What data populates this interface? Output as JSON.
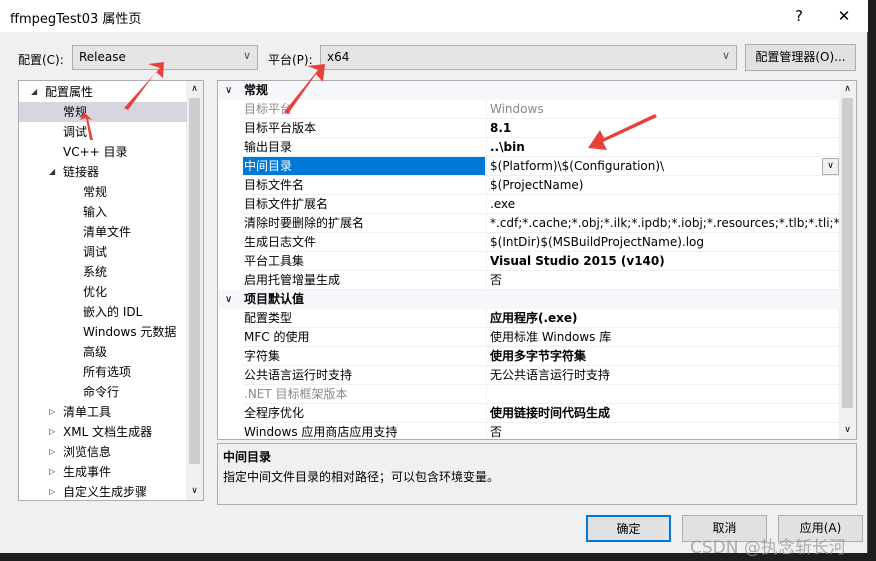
{
  "window": {
    "title": "ffmpegTest03 属性页",
    "help": "?",
    "close": "✕"
  },
  "toolbar": {
    "config_label": "配置(C):",
    "config_value": "Release",
    "platform_label": "平台(P):",
    "platform_value": "x64",
    "manager_button": "配置管理器(O)..."
  },
  "tree": [
    {
      "label": "配置属性",
      "expander": "◢",
      "indent": 0
    },
    {
      "label": "常规",
      "indent": 1,
      "selected": true
    },
    {
      "label": "调试",
      "indent": 1
    },
    {
      "label": "VC++ 目录",
      "indent": 1
    },
    {
      "label": "链接器",
      "expander": "◢",
      "indent": 1
    },
    {
      "label": "常规",
      "indent": 2
    },
    {
      "label": "输入",
      "indent": 2
    },
    {
      "label": "清单文件",
      "indent": 2
    },
    {
      "label": "调试",
      "indent": 2
    },
    {
      "label": "系统",
      "indent": 2
    },
    {
      "label": "优化",
      "indent": 2
    },
    {
      "label": "嵌入的 IDL",
      "indent": 2
    },
    {
      "label": "Windows 元数据",
      "indent": 2
    },
    {
      "label": "高级",
      "indent": 2
    },
    {
      "label": "所有选项",
      "indent": 2
    },
    {
      "label": "命令行",
      "indent": 2
    },
    {
      "label": "清单工具",
      "expander": "▷",
      "indent": 1
    },
    {
      "label": "XML 文档生成器",
      "expander": "▷",
      "indent": 1
    },
    {
      "label": "浏览信息",
      "expander": "▷",
      "indent": 1
    },
    {
      "label": "生成事件",
      "expander": "▷",
      "indent": 1
    },
    {
      "label": "自定义生成步骤",
      "expander": "▷",
      "indent": 1
    }
  ],
  "grid": [
    {
      "category": "常规"
    },
    {
      "key": "目标平台",
      "value": "Windows",
      "disabled": true
    },
    {
      "key": "目标平台版本",
      "value": "8.1",
      "bold": true
    },
    {
      "key": "输出目录",
      "value": "..\\bin",
      "bold": true
    },
    {
      "key": "中间目录",
      "value": "$(Platform)\\$(Configuration)\\",
      "selected": true
    },
    {
      "key": "目标文件名",
      "value": "$(ProjectName)"
    },
    {
      "key": "目标文件扩展名",
      "value": ".exe"
    },
    {
      "key": "清除时要删除的扩展名",
      "value": "*.cdf;*.cache;*.obj;*.ilk;*.ipdb;*.iobj;*.resources;*.tlb;*.tli;*.tlh;*.tmp"
    },
    {
      "key": "生成日志文件",
      "value": "$(IntDir)$(MSBuildProjectName).log"
    },
    {
      "key": "平台工具集",
      "value": "Visual Studio 2015 (v140)",
      "bold": true
    },
    {
      "key": "启用托管增量生成",
      "value": "否"
    },
    {
      "category": "项目默认值"
    },
    {
      "key": "配置类型",
      "value": "应用程序(.exe)",
      "bold": true
    },
    {
      "key": "MFC 的使用",
      "value": "使用标准 Windows 库"
    },
    {
      "key": "字符集",
      "value": "使用多字节字符集",
      "bold": true
    },
    {
      "key": "公共语言运行时支持",
      "value": "无公共语言运行时支持"
    },
    {
      "key": ".NET 目标框架版本",
      "value": "",
      "disabled": true
    },
    {
      "key": "全程序优化",
      "value": "使用链接时间代码生成",
      "bold": true
    },
    {
      "key": "Windows 应用商店应用支持",
      "value": "否"
    }
  ],
  "description": {
    "title": "中间目录",
    "text": "指定中间文件目录的相对路径；可以包含环境变量。"
  },
  "buttons": {
    "ok": "确定",
    "cancel": "取消",
    "apply": "应用(A)"
  },
  "watermark": "CSDN @执念斩长河",
  "colors": {
    "selection": "#0078d7",
    "annotation_arrow": "#e8403a"
  }
}
